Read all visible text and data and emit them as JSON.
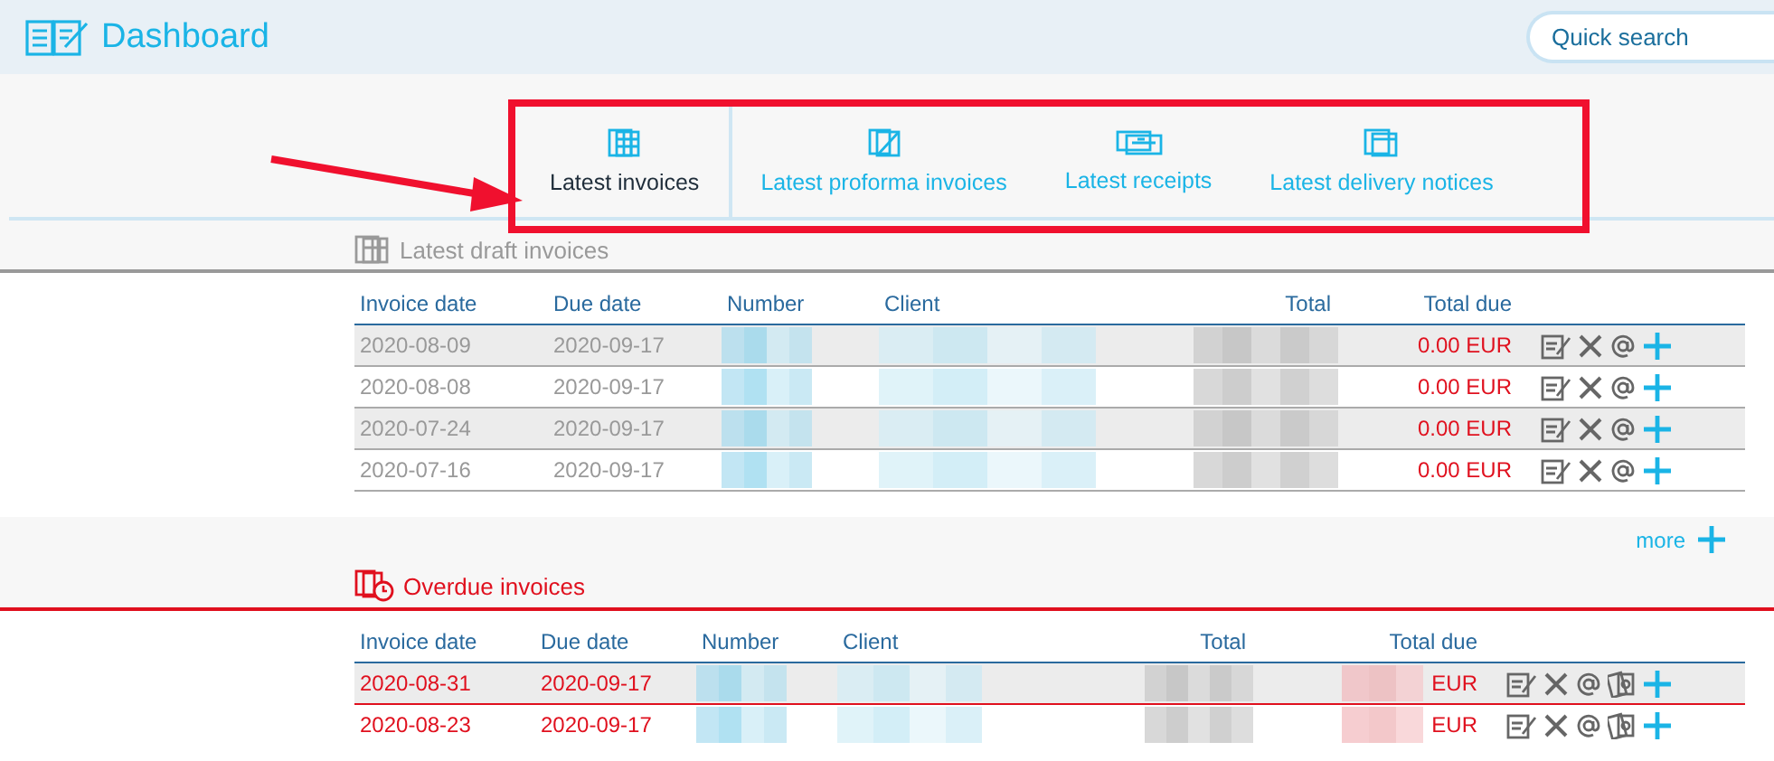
{
  "header": {
    "title": "Dashboard",
    "search": {
      "placeholder": "Quick search"
    }
  },
  "tabs": [
    {
      "label": "Latest invoices",
      "kind": "invoices",
      "selected": true
    },
    {
      "label": "Latest proforma invoices",
      "kind": "proforma",
      "selected": false
    },
    {
      "label": "Latest receipts",
      "kind": "receipts",
      "selected": false
    },
    {
      "label": "Latest delivery notices",
      "kind": "delivery",
      "selected": false
    }
  ],
  "annotation": {
    "kind": "highlight"
  },
  "sections": [
    {
      "kind": "draft",
      "title": "Latest draft invoices",
      "columns": [
        "Invoice date",
        "Due date",
        "Number",
        "Client",
        "Total",
        "Total due"
      ],
      "rows": [
        {
          "invoice_date": "2020-08-09",
          "due_date": "2020-09-17",
          "total_due": "0.00 EUR",
          "actions": [
            {
              "kind": "edit"
            },
            {
              "kind": "delete"
            },
            {
              "kind": "email"
            },
            {
              "kind": "add"
            }
          ]
        },
        {
          "invoice_date": "2020-08-08",
          "due_date": "2020-09-17",
          "total_due": "0.00 EUR",
          "actions": [
            {
              "kind": "edit"
            },
            {
              "kind": "delete"
            },
            {
              "kind": "email"
            },
            {
              "kind": "add"
            }
          ]
        },
        {
          "invoice_date": "2020-07-24",
          "due_date": "2020-09-17",
          "total_due": "0.00 EUR",
          "actions": [
            {
              "kind": "edit"
            },
            {
              "kind": "delete"
            },
            {
              "kind": "email"
            },
            {
              "kind": "add"
            }
          ]
        },
        {
          "invoice_date": "2020-07-16",
          "due_date": "2020-09-17",
          "total_due": "0.00 EUR",
          "actions": [
            {
              "kind": "edit"
            },
            {
              "kind": "delete"
            },
            {
              "kind": "email"
            },
            {
              "kind": "add"
            }
          ]
        }
      ],
      "more": "more"
    },
    {
      "kind": "overdue",
      "title": "Overdue invoices",
      "columns": [
        "Invoice date",
        "Due date",
        "Number",
        "Client",
        "Total",
        "Total due"
      ],
      "rows": [
        {
          "invoice_date": "2020-08-31",
          "due_date": "2020-09-17",
          "total_due": "EUR",
          "actions": [
            {
              "kind": "edit"
            },
            {
              "kind": "delete"
            },
            {
              "kind": "email"
            },
            {
              "kind": "pay"
            },
            {
              "kind": "add"
            }
          ]
        },
        {
          "invoice_date": "2020-08-23",
          "due_date": "2020-09-17",
          "total_due": "EUR",
          "actions": [
            {
              "kind": "edit"
            },
            {
              "kind": "delete"
            },
            {
              "kind": "email"
            },
            {
              "kind": "pay"
            },
            {
              "kind": "add"
            }
          ]
        }
      ]
    }
  ]
}
